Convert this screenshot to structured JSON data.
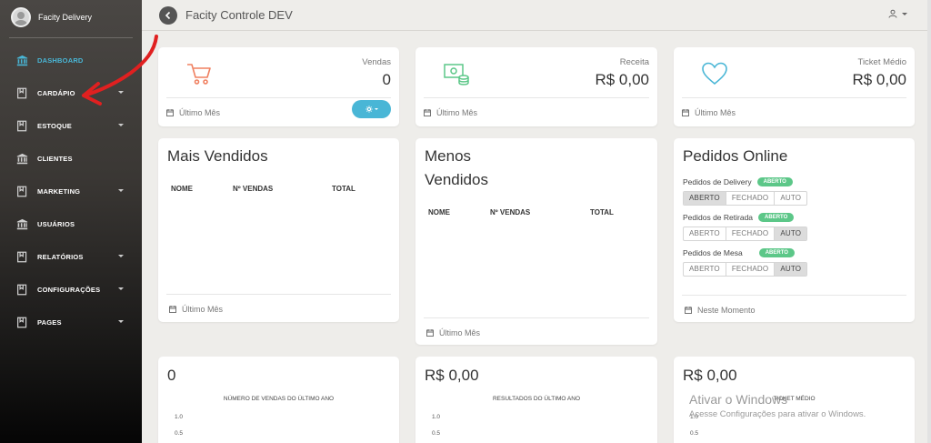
{
  "sidebar": {
    "brand_name": "Facity Delivery",
    "items": [
      {
        "label": "DASHBOARD",
        "icon": "bank-icon",
        "active": true
      },
      {
        "label": "CARDÁPIO",
        "icon": "book-icon",
        "caret": true
      },
      {
        "label": "ESTOQUE",
        "icon": "book-icon",
        "caret": true
      },
      {
        "label": "CLIENTES",
        "icon": "bank-icon"
      },
      {
        "label": "MARKETING",
        "icon": "book-icon",
        "caret": true
      },
      {
        "label": "USUÁRIOS",
        "icon": "bank-icon"
      },
      {
        "label": "RELATÓRIOS",
        "icon": "book-icon",
        "caret": true
      },
      {
        "label": "CONFIGURAÇÕES",
        "icon": "book-icon",
        "caret": true
      },
      {
        "label": "PAGES",
        "icon": "book-icon",
        "caret": true
      }
    ]
  },
  "header": {
    "title": "Facity Controle DEV"
  },
  "stats": {
    "vendas": {
      "label": "Vendas",
      "value": "0",
      "footer": "Último Mês"
    },
    "receita": {
      "label": "Receita",
      "value": "R$ 0,00",
      "footer": "Último Mês"
    },
    "ticket": {
      "label": "Ticket Médio",
      "value": "R$ 0,00",
      "footer": "Último Mês"
    }
  },
  "mais_vendidos": {
    "title": "Mais Vendidos",
    "columns": [
      "NOME",
      "Nº VENDAS",
      "TOTAL"
    ],
    "footer": "Último Mês"
  },
  "menos_vendidos": {
    "title_line1": "Menos",
    "title_line2": "Vendidos",
    "columns": [
      "NOME",
      "Nº VENDAS",
      "TOTAL"
    ],
    "footer": "Último Mês"
  },
  "pedidos_online": {
    "title": "Pedidos Online",
    "rows": [
      {
        "label": "Pedidos de Delivery",
        "badge": "ABERTO",
        "options": [
          "ABERTO",
          "FECHADO",
          "AUTO"
        ],
        "selected": "ABERTO"
      },
      {
        "label": "Pedidos de Retirada",
        "badge": "ABERTO",
        "options": [
          "ABERTO",
          "FECHADO",
          "AUTO"
        ],
        "selected": "AUTO"
      },
      {
        "label": "Pedidos de Mesa",
        "badge": "ABERTO",
        "options": [
          "ABERTO",
          "FECHADO",
          "AUTO"
        ],
        "selected": "AUTO"
      }
    ],
    "footer": "Neste Momento"
  },
  "charts": [
    {
      "value": "0",
      "title": "NÚMERO DE VENDAS DO ÚLTIMO ANO",
      "ticks": [
        "1.0",
        "0.5"
      ]
    },
    {
      "value": "R$ 0,00",
      "title": "RESULTADOS DO ÚLTIMO ANO",
      "ticks": [
        "1.0",
        "0.5"
      ]
    },
    {
      "value": "R$ 0,00",
      "title": "TICKET MÉDIO",
      "ticks": [
        "1.0",
        "0.5"
      ]
    }
  ],
  "watermark": {
    "title": "Ativar o Windows",
    "subtitle": "Acesse Configurações para ativar o Windows."
  },
  "colors": {
    "accent": "#49b6d6",
    "badge_green": "#5cc788",
    "cart_icon": "#f08060",
    "money_icon": "#5cc788",
    "heart_icon": "#49b6d6",
    "annotation_arrow": "#e02020"
  }
}
